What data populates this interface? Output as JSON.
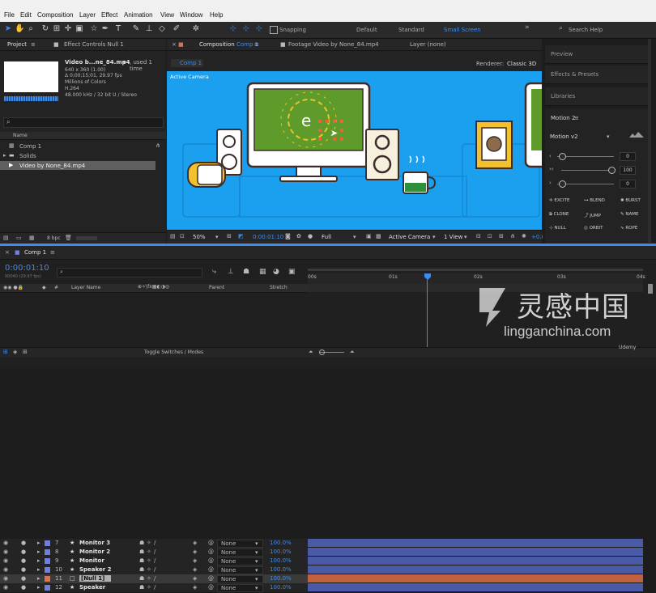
{
  "menu": [
    "File",
    "Edit",
    "Composition",
    "Layer",
    "Effect",
    "Animation",
    "View",
    "Window",
    "Help"
  ],
  "toolbar": {
    "snapping_label": "Snapping",
    "workspaces": [
      "Default",
      "Standard",
      "Small Screen"
    ],
    "active_workspace": "Small Screen",
    "search_placeholder": "Search Help"
  },
  "project_panel": {
    "tab_project": "Project",
    "tab_effect_controls": "Effect Controls Null 1",
    "item_name": "Video b...ne_84.mp4",
    "used_times": ", used 1 time",
    "info_lines": [
      "640 x 360 (1.00)",
      "Δ 0;00;15;01, 29.97 fps",
      "Millions of Colors",
      "H.264",
      "48.000 kHz / 32 bit U / Stereo"
    ],
    "name_header": "Name",
    "items": [
      "Comp 1",
      "Solids",
      "Video by None_84.mp4"
    ],
    "bpc": "8 bpc"
  },
  "composition_viewer": {
    "tab_composition_prefix": "Composition",
    "tab_composition_name": "Comp 1",
    "tab_footage": "Footage Video by None_84.mp4",
    "tab_layer": "Layer (none)",
    "comp_chip": "Comp 1",
    "renderer_label": "Renderer:",
    "renderer_value": "Classic 3D",
    "active_camera_label": "Active Camera",
    "zoom": "50%",
    "timecode": "0:00:01:10",
    "resolution": "Full",
    "camera_view": "Active Camera",
    "views": "1 View",
    "exposure": "+0.0",
    "stage_bg": "#1aa0ef"
  },
  "right_panel": {
    "preview": "Preview",
    "effects_presets": "Effects & Presets",
    "libraries": "Libraries",
    "motion_title": "Motion 2",
    "motion_version": "Motion v2",
    "values": [
      "0",
      "100",
      "0"
    ],
    "buttons": [
      "EXCITE",
      "BLEND",
      "BURST",
      "CLONE",
      "JUMP",
      "NAME",
      "NULL",
      "ORBIT",
      "ROPE"
    ]
  },
  "timeline": {
    "comp_tab": "Comp 1",
    "timecode": "0:00:01:10",
    "frame_info": "00040 (29.97 fps)",
    "search_placeholder": "",
    "col_layer_name": "Layer Name",
    "col_parent": "Parent",
    "col_stretch": "Stretch",
    "ruler_labels": [
      "00s",
      "01s",
      "02s",
      "03s",
      "04s"
    ],
    "layers": [
      {
        "num": "7",
        "name": "Monitor 3",
        "parent": "None",
        "stretch": "100.0%",
        "label_color": "#6d7fe0",
        "bar_color": "#4a5aa6"
      },
      {
        "num": "8",
        "name": "Monitor 2",
        "parent": "None",
        "stretch": "100.0%",
        "label_color": "#6d7fe0",
        "bar_color": "#4a5aa6"
      },
      {
        "num": "9",
        "name": "Monitor",
        "parent": "None",
        "stretch": "100.0%",
        "label_color": "#6d7fe0",
        "bar_color": "#4a5aa6"
      },
      {
        "num": "10",
        "name": "Speaker 2",
        "parent": "None",
        "stretch": "100.0%",
        "label_color": "#6d7fe0",
        "bar_color": "#4a5aa6"
      },
      {
        "num": "11",
        "name": "[Null 1]",
        "parent": "None",
        "stretch": "100.0%",
        "label_color": "#d8734f",
        "bar_color": "#c2613f"
      },
      {
        "num": "12",
        "name": "Speaker",
        "parent": "None",
        "stretch": "100.0%",
        "label_color": "#6d7fe0",
        "bar_color": "#4a5aa6"
      }
    ],
    "toggle_label": "Toggle Switches / Modes"
  },
  "watermark": {
    "logo_text": "灵感中国",
    "site": "lingganchina.com",
    "brand": "Udemy"
  }
}
